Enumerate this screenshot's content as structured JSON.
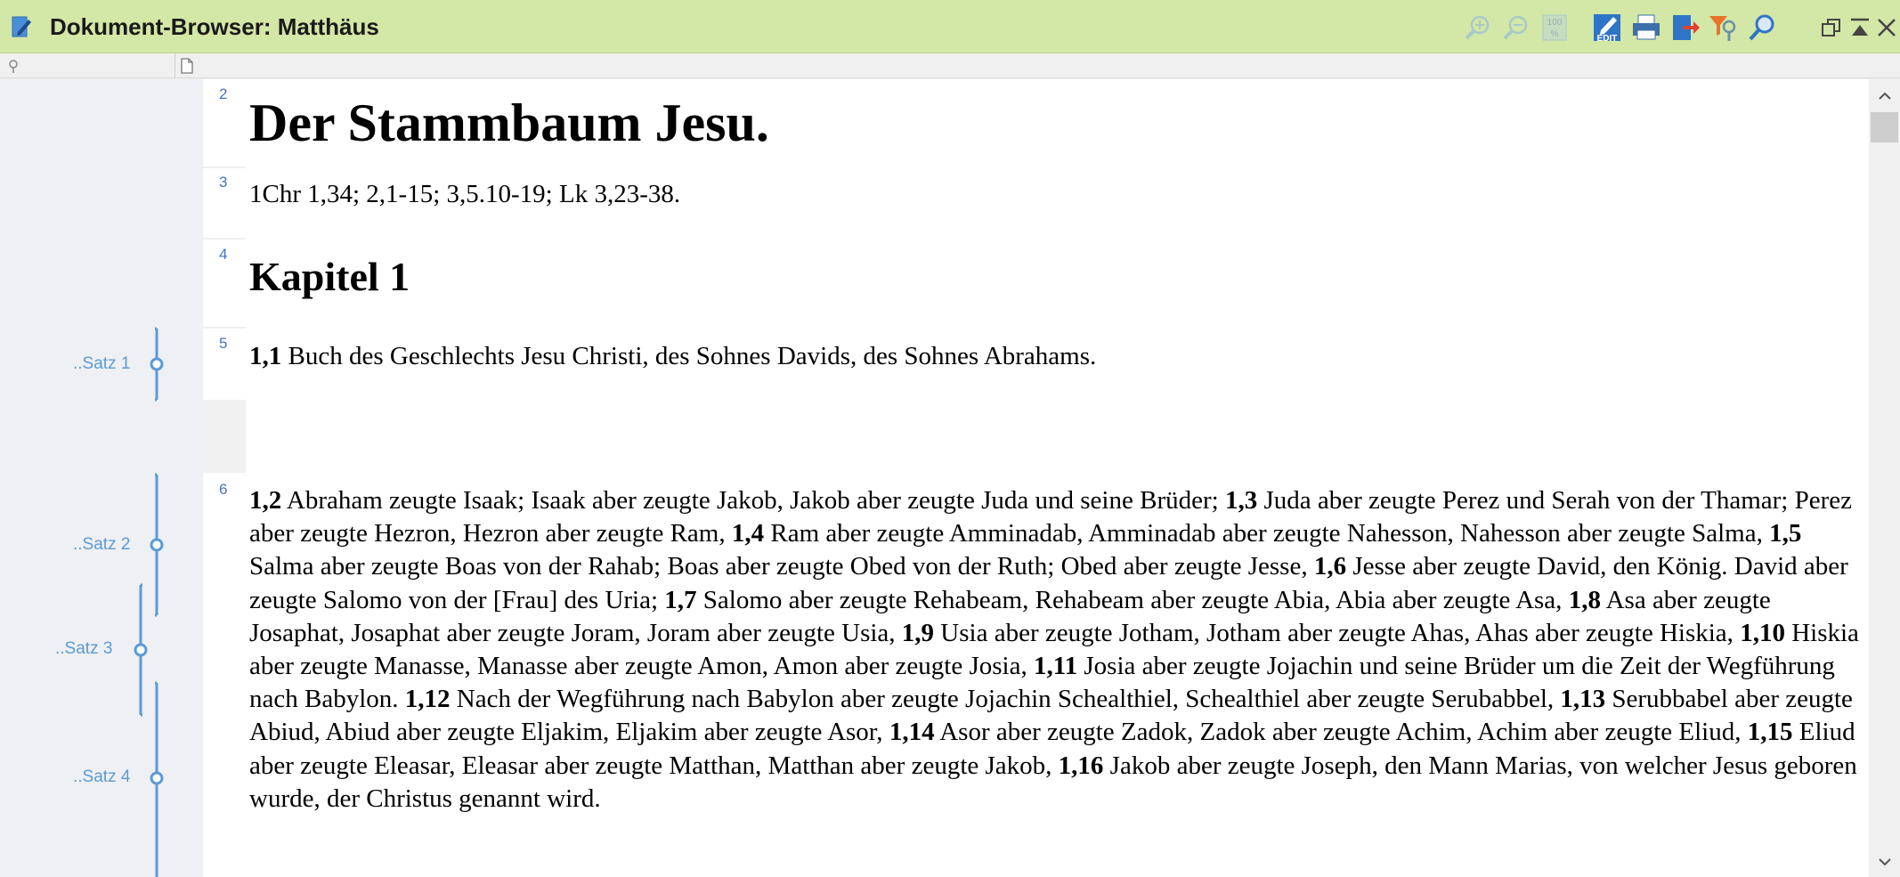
{
  "window": {
    "title": "Dokument-Browser: Matthäus"
  },
  "toolbar": {
    "icons": [
      "zoom-in-icon",
      "zoom-out-icon",
      "zoom-100-icon",
      "edit-icon",
      "print-icon",
      "export-icon",
      "filter-icon",
      "search-icon"
    ],
    "edit_label": "EDIT",
    "zoom100_label": "100%"
  },
  "window_controls": [
    "restore-icon",
    "minimize-up-icon",
    "close-icon"
  ],
  "gutter": {
    "satz_labels": [
      "..Satz 1",
      "..Satz 2",
      "..Satz 3",
      "..Satz 4"
    ],
    "bracket_color": "#5b9bd5"
  },
  "paragraphs": {
    "numbers": [
      "2",
      "3",
      "4",
      "5",
      "6"
    ],
    "heading": "Der Stammbaum Jesu.",
    "references": "1Chr 1,34; 2,1-15; 3,5.10-19; Lk 3,23-38.",
    "chapter": "Kapitel 1",
    "verse_1_1": {
      "num": "1,1",
      "text": " Buch des Geschlechts Jesu Christi, des Sohnes Davids, des Sohnes Abrahams."
    },
    "para_6": [
      {
        "num": "1,2",
        "text": " Abraham zeugte Isaak; Isaak aber zeugte Jakob, Jakob aber zeugte Juda und seine Brüder; "
      },
      {
        "num": "1,3",
        "text": " Juda aber zeugte Perez und Serah von der Thamar; Perez aber zeugte Hezron, Hezron aber zeugte Ram, "
      },
      {
        "num": "1,4",
        "text": " Ram aber zeugte Amminadab, Amminadab aber zeugte Nahesson, Nahesson aber zeugte Salma, "
      },
      {
        "num": "1,5",
        "text": " Salma aber zeugte Boas von der Rahab; Boas aber zeugte Obed von der Ruth; Obed aber zeugte Jesse, "
      },
      {
        "num": "1,6",
        "text": " Jesse aber zeugte David, den König. David aber zeugte Salomo von der [Frau] des Uria; "
      },
      {
        "num": "1,7",
        "text": " Salomo aber zeugte Rehabeam, Rehabeam aber zeugte Abia, Abia aber zeugte Asa, "
      },
      {
        "num": "1,8",
        "text": " Asa aber zeugte Josaphat, Josaphat aber zeugte Joram, Joram aber zeugte Usia, "
      },
      {
        "num": "1,9",
        "text": " Usia aber zeugte Jotham, Jotham aber zeugte Ahas, Ahas aber zeugte Hiskia, "
      },
      {
        "num": "1,10",
        "text": " Hiskia aber zeugte Manasse, Manasse aber zeugte Amon, Amon aber zeugte Josia, "
      },
      {
        "num": "1,11",
        "text": " Josia aber zeugte Jojachin und seine Brüder um die Zeit der Wegführung nach Babylon. "
      },
      {
        "num": "1,12",
        "text": " Nach der Wegführung nach Babylon aber zeugte Jojachin Schealthiel, Schealthiel aber zeugte Serubabbel, "
      },
      {
        "num": "1,13",
        "text": " Serubbabel aber zeugte Abiud, Abiud aber zeugte Eljakim, Eljakim aber zeugte Asor, "
      },
      {
        "num": "1,14",
        "text": " Asor aber zeugte Zadok, Zadok aber zeugte Achim, Achim aber zeugte Eliud, "
      },
      {
        "num": "1,15",
        "text": " Eliud aber zeugte Eleasar, Eleasar aber zeugte Matthan, Matthan aber zeugte Jakob, "
      },
      {
        "num": "1,16",
        "text": " Jakob aber zeugte Joseph, den Mann Marias, von welcher Jesus geboren wurde, der Christus genannt wird."
      }
    ]
  },
  "colors": {
    "titlebar_bg": "#d3e7a6",
    "paragraph_number": "#4472c4",
    "satz_label": "#5b9bd5"
  }
}
